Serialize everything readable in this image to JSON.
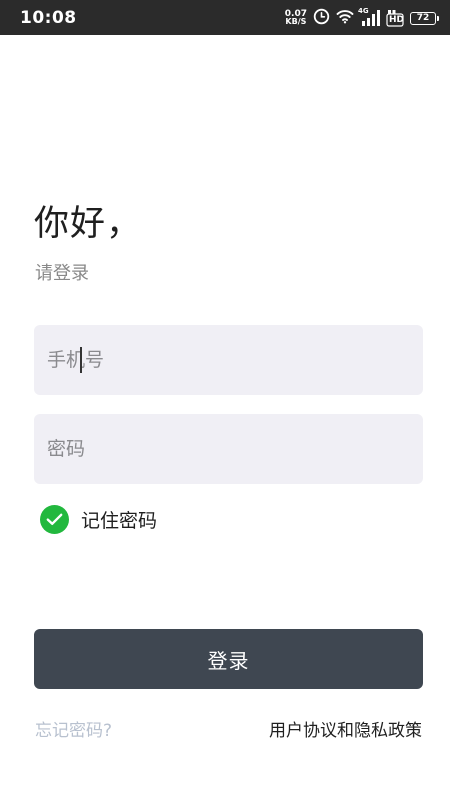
{
  "status_bar": {
    "time": "10:08",
    "net_speed_value": "0.07",
    "net_speed_unit": "KB/S",
    "network_type": "4G",
    "hd_label": "HD",
    "battery_level": "72",
    "icons": [
      "clock-icon",
      "wifi-icon",
      "signal-icon",
      "hd-icon",
      "battery-icon"
    ]
  },
  "login": {
    "greeting": "你好，",
    "subtitle": "请登录",
    "phone_placeholder": "手机号",
    "phone_value": "",
    "password_placeholder": "密码",
    "password_value": "",
    "remember_label": "记住密码",
    "remember_checked": true,
    "submit_label": "登录",
    "forgot_label": "忘记密码?",
    "policy_label": "用户协议和隐私政策"
  },
  "colors": {
    "status_bar_bg": "#2b2b2b",
    "input_bg": "#f0eff5",
    "check_green": "#22b83e",
    "button_bg": "#3f4751",
    "forgot_link": "#b8c1cf"
  }
}
